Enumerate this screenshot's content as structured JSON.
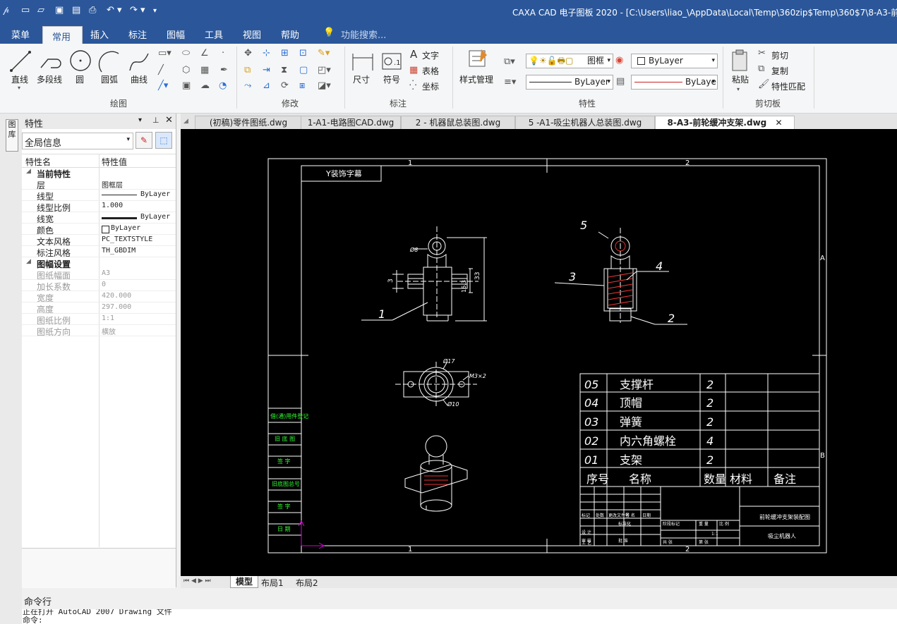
{
  "window": {
    "title": "CAXA CAD 电子图板 2020 - [C:\\Users\\liao_\\AppData\\Local\\Temp\\360zip$Temp\\360$7\\8-A3-前轮缓冲支"
  },
  "menu": {
    "items": [
      "菜单",
      "常用",
      "插入",
      "标注",
      "图幅",
      "工具",
      "视图",
      "帮助"
    ],
    "search": "功能搜索..."
  },
  "ribbon": {
    "draw_group": "绘图",
    "draw_tools": [
      "直线",
      "多段线",
      "圆",
      "圆弧",
      "曲线"
    ],
    "modify_group": "修改",
    "annotate_group": "标注",
    "annotate_tools": [
      "尺寸",
      "符号"
    ],
    "annotate_small": [
      "文字",
      "表格",
      "坐标"
    ],
    "style_group": "特性",
    "style_manager": "样式管理",
    "layer_combo": "图框",
    "color_combo": "ByLayer",
    "linetype_combo": "ByLayer",
    "lineweight_combo": "ByLaye",
    "clipboard_group": "剪切板",
    "paste": "粘贴",
    "clip_small": [
      "剪切",
      "复制",
      "特性匹配"
    ]
  },
  "properties_panel": {
    "title": "特性",
    "scope_combo": "全局信息",
    "col_name": "特性名",
    "col_value": "特性值",
    "section_current": "当前特性",
    "current_rows": [
      {
        "name": "层",
        "value": "图框层"
      },
      {
        "name": "线型",
        "value": "ByLayer"
      },
      {
        "name": "线型比例",
        "value": "1.000"
      },
      {
        "name": "线宽",
        "value": "ByLayer"
      },
      {
        "name": "颜色",
        "value": "ByLayer"
      },
      {
        "name": "文本风格",
        "value": "PC_TEXTSTYLE"
      },
      {
        "name": "标注风格",
        "value": "TH_GBDIM"
      }
    ],
    "section_sheet": "图幅设置",
    "sheet_rows": [
      {
        "name": "图纸幅面",
        "value": "A3"
      },
      {
        "name": "加长系数",
        "value": "0"
      },
      {
        "name": "宽度",
        "value": "420.000"
      },
      {
        "name": "高度",
        "value": "297.000"
      },
      {
        "name": "图纸比例",
        "value": "1:1"
      },
      {
        "name": "图纸方向",
        "value": "横放"
      }
    ]
  },
  "left_strip_label": "图库",
  "tabs": [
    {
      "label": "(初稿)零件图纸.dwg",
      "active": false
    },
    {
      "label": "1-A1-电路图CAD.dwg",
      "active": false
    },
    {
      "label": "2 - 机器鼠总装图.dwg",
      "active": false
    },
    {
      "label": "5 -A1-吸尘机器人总装图.dwg",
      "active": false
    },
    {
      "label": "8-A3-前轮缓冲支架.dwg",
      "active": true
    }
  ],
  "drawing": {
    "title_box": "Y装饰字幕",
    "zone_top": [
      "1",
      "2"
    ],
    "zone_bottom": [
      "1",
      "2"
    ],
    "zone_side": [
      "A",
      "B"
    ],
    "dims": {
      "phi8": "Ø8",
      "d33": "33",
      "d163": "16.3",
      "d3": "3",
      "phi17": "Ø17",
      "phi10": "Ø10",
      "m3": "M3×2"
    },
    "balloons": [
      "1",
      "2",
      "3",
      "4",
      "5"
    ],
    "left_labels": [
      "借(通)用件登记",
      "旧 底 图",
      "签 字",
      "旧底图总号",
      "签 字",
      "日 期"
    ],
    "bom": [
      {
        "no": "05",
        "name": "支撑杆",
        "qty": "2"
      },
      {
        "no": "04",
        "name": "顶帽",
        "qty": "2"
      },
      {
        "no": "03",
        "name": "弹簧",
        "qty": "2"
      },
      {
        "no": "02",
        "name": "内六角螺栓",
        "qty": "4"
      },
      {
        "no": "01",
        "name": "支架",
        "qty": "2"
      }
    ],
    "bom_header": {
      "no": "序号",
      "name": "名称",
      "qty": "数量",
      "material": "材料",
      "remark": "备注"
    },
    "title_block": {
      "drawing_name": "前轮缓冲支架装配图",
      "company": "吸尘机器人",
      "cells": [
        "标记",
        "处数",
        "更改文件号",
        "签 名",
        "日期",
        "设 计",
        "标准化",
        "阶段标记",
        "重 量",
        "比 例",
        "审 核",
        "工 艺",
        "批 准",
        "共 张",
        "第 张",
        "1:1"
      ]
    }
  },
  "layout_tabs": [
    "模型",
    "布局1",
    "布局2"
  ],
  "command": {
    "label": "命令行",
    "lines": [
      "正在打开 AutoCAD 2007 Drawing 文件",
      "命令:"
    ]
  }
}
